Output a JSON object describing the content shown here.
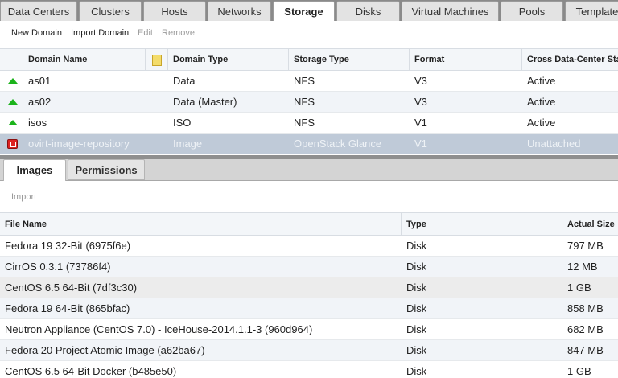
{
  "top_tabs": [
    {
      "label": "Data Centers",
      "active": false
    },
    {
      "label": "Clusters",
      "active": false
    },
    {
      "label": "Hosts",
      "active": false
    },
    {
      "label": "Networks",
      "active": false
    },
    {
      "label": "Storage",
      "active": true
    },
    {
      "label": "Disks",
      "active": false
    },
    {
      "label": "Virtual Machines",
      "active": false
    },
    {
      "label": "Pools",
      "active": false
    },
    {
      "label": "Template",
      "active": false
    }
  ],
  "main_toolbar": {
    "new_domain": "New Domain",
    "import_domain": "Import Domain",
    "edit": "Edit",
    "remove": "Remove"
  },
  "main_grid": {
    "columns": [
      "Domain Name",
      "Domain Type",
      "Storage Type",
      "Format",
      "Cross Data-Center Status"
    ],
    "rows": [
      {
        "status_icon": "up-arrow-icon",
        "name": "as01",
        "type": "Data",
        "storage": "NFS",
        "format": "V3",
        "cross": "Active",
        "selected": false
      },
      {
        "status_icon": "up-arrow-icon",
        "name": "as02",
        "type": "Data (Master)",
        "storage": "NFS",
        "format": "V3",
        "cross": "Active",
        "selected": false
      },
      {
        "status_icon": "up-arrow-icon",
        "name": "isos",
        "type": "ISO",
        "storage": "NFS",
        "format": "V1",
        "cross": "Active",
        "selected": false
      },
      {
        "status_icon": "down-icon",
        "name": "ovirt-image-repository",
        "type": "Image",
        "storage": "OpenStack Glance",
        "format": "V1",
        "cross": "Unattached",
        "selected": true
      }
    ]
  },
  "sub_tabs": [
    {
      "label": "Images",
      "active": true
    },
    {
      "label": "Permissions",
      "active": false
    }
  ],
  "sub_toolbar": {
    "import": "Import"
  },
  "sub_grid": {
    "columns": [
      "File Name",
      "Type",
      "Actual Size"
    ],
    "rows": [
      {
        "file": "Fedora 19 32-Bit (6975f6e)",
        "type": "Disk",
        "size": "797 MB"
      },
      {
        "file": "CirrOS 0.3.1 (73786f4)",
        "type": "Disk",
        "size": "12 MB"
      },
      {
        "file": "CentOS 6.5 64-Bit (7df3c30)",
        "type": "Disk",
        "size": "1 GB"
      },
      {
        "file": "Fedora 19 64-Bit (865bfac)",
        "type": "Disk",
        "size": "858 MB"
      },
      {
        "file": "Neutron Appliance (CentOS 7.0) - IceHouse-2014.1.1-3 (960d964)",
        "type": "Disk",
        "size": "682 MB"
      },
      {
        "file": "Fedora 20 Project Atomic Image (a62ba67)",
        "type": "Disk",
        "size": "847 MB"
      },
      {
        "file": "CentOS 6.5 64-Bit Docker (b485e50)",
        "type": "Disk",
        "size": "1 GB"
      }
    ]
  },
  "colors": {
    "selected_row": "#bfcad8",
    "up_icon": "#1bb31b",
    "down_icon": "#dd2222"
  }
}
